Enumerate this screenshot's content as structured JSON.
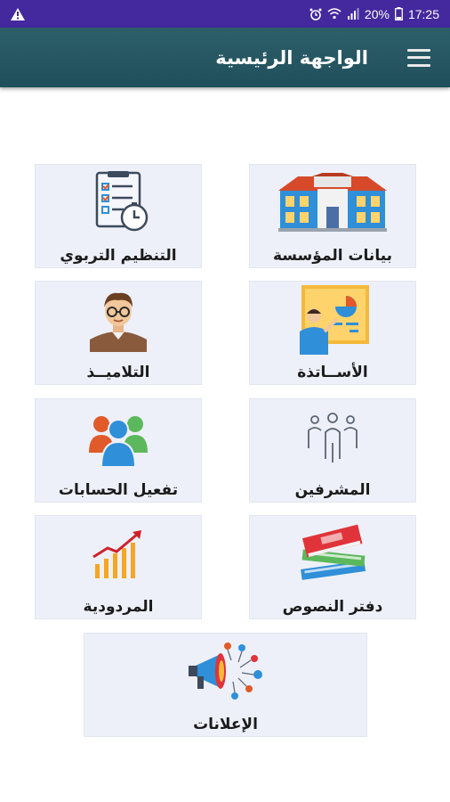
{
  "status_bar": {
    "warning_icon": "warning-triangle-icon",
    "battery_percent": "20%",
    "time": "17:25"
  },
  "app_bar": {
    "title": "الواجهة الرئيسية",
    "menu_icon": "hamburger-menu-icon"
  },
  "tiles": [
    {
      "label": "بيانات المؤسسة",
      "icon": "school-building-icon"
    },
    {
      "label": "التنظيم التربوي",
      "icon": "checklist-clock-icon"
    },
    {
      "label": "الأســاتذة",
      "icon": "teacher-board-icon"
    },
    {
      "label": "التلاميــذ",
      "icon": "student-icon"
    },
    {
      "label": "المشرفين",
      "icon": "supervisors-group-icon"
    },
    {
      "label": "تفعيل الحسابات",
      "icon": "users-group-icon"
    },
    {
      "label": "دفتر النصوص",
      "icon": "books-stack-icon"
    },
    {
      "label": "المردودية",
      "icon": "growth-chart-icon"
    },
    {
      "label": "الإعلانات",
      "icon": "megaphone-icon"
    }
  ],
  "colors": {
    "status_bar": "#43289e",
    "app_bar": "#2d5f6a",
    "tile_bg": "#edf0f8"
  }
}
